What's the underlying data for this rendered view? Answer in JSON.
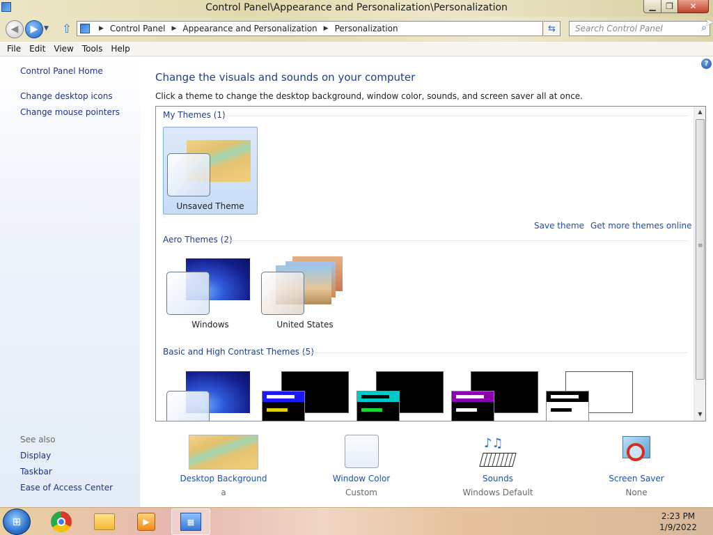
{
  "window": {
    "title": "Control Panel\\Appearance and Personalization\\Personalization",
    "minimize_glyph": "▁",
    "maximize_glyph": "❐",
    "close_glyph": "✕"
  },
  "nav": {
    "back_glyph": "◀",
    "forward_glyph": "▶",
    "up_glyph": "⇧",
    "history_glyph": "▼",
    "breadcrumb": [
      "Control Panel",
      "Appearance and Personalization",
      "Personalization"
    ],
    "breadcrumb_sep": "▶",
    "dropdown_glyph": "▼",
    "refresh_glyph": "⇆",
    "search_placeholder": "Search Control Panel",
    "search_glyph": "⌕"
  },
  "menu": [
    "File",
    "Edit",
    "View",
    "Tools",
    "Help"
  ],
  "sidebar": {
    "home": "Control Panel Home",
    "links": [
      "Change desktop icons",
      "Change mouse pointers"
    ],
    "see_also_label": "See also",
    "see_also": [
      "Display",
      "Taskbar",
      "Ease of Access Center"
    ]
  },
  "main": {
    "help_glyph": "?",
    "title": "Change the visuals and sounds on your computer",
    "description": "Click a theme to change the desktop background, window color, sounds, and screen saver all at once.",
    "groups": {
      "my_themes": "My Themes (1)",
      "aero_themes": "Aero Themes (2)",
      "basic_themes": "Basic and High Contrast Themes (5)"
    },
    "my_theme_tiles": [
      {
        "label": "Unsaved Theme",
        "selected": true
      }
    ],
    "aero_theme_tiles": [
      {
        "label": "Windows"
      },
      {
        "label": "United States"
      }
    ],
    "save_theme": "Save theme",
    "get_more": "Get more themes online",
    "scroll_up": "▲",
    "scroll_down": "▼",
    "scroll_grip": "≡"
  },
  "bottom": [
    {
      "label": "Desktop Background",
      "value": "a"
    },
    {
      "label": "Window Color",
      "value": "Custom"
    },
    {
      "label": "Sounds",
      "value": "Windows Default"
    },
    {
      "label": "Screen Saver",
      "value": "None"
    }
  ],
  "taskbar": {
    "start_glyph": "⊞",
    "time": "2:23 PM",
    "date": "1/9/2022",
    "media_glyph": "▶",
    "cp_glyph": "▦"
  },
  "colors": {
    "link": "#1f4fa8",
    "heading": "#1e3d8c",
    "high_contrast_accents": [
      "#1a1aff",
      "#00c9c9",
      "#8a00b0",
      "#000000"
    ]
  }
}
